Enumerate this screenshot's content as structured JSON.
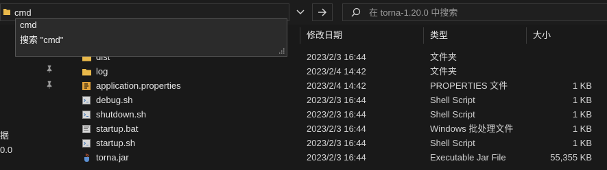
{
  "address_bar": {
    "value": "cmd"
  },
  "search": {
    "placeholder": "在 torna-1.20.0 中搜索"
  },
  "suggestions": [
    "cmd",
    "搜索 \"cmd\""
  ],
  "left_pane": {
    "partial_labels": [
      "据",
      "0.0"
    ]
  },
  "columns": {
    "date": "修改日期",
    "type": "类型",
    "size": "大小"
  },
  "files": [
    {
      "name": "dist",
      "date": "2023/2/3 16:44",
      "type": "文件夹",
      "size": "",
      "icon": "folder-icon"
    },
    {
      "name": "log",
      "date": "2023/2/4 14:42",
      "type": "文件夹",
      "size": "",
      "icon": "folder-icon"
    },
    {
      "name": "application.properties",
      "date": "2023/2/4 14:42",
      "type": "PROPERTIES 文件",
      "size": "1 KB",
      "icon": "properties-file-icon"
    },
    {
      "name": "debug.sh",
      "date": "2023/2/3 16:44",
      "type": "Shell Script",
      "size": "1 KB",
      "icon": "script-file-icon"
    },
    {
      "name": "shutdown.sh",
      "date": "2023/2/3 16:44",
      "type": "Shell Script",
      "size": "1 KB",
      "icon": "script-file-icon"
    },
    {
      "name": "startup.bat",
      "date": "2023/2/3 16:44",
      "type": "Windows 批处理文件",
      "size": "1 KB",
      "icon": "batch-file-icon"
    },
    {
      "name": "startup.sh",
      "date": "2023/2/3 16:44",
      "type": "Shell Script",
      "size": "1 KB",
      "icon": "script-file-icon"
    },
    {
      "name": "torna.jar",
      "date": "2023/2/3 16:44",
      "type": "Executable Jar File",
      "size": "55,355 KB",
      "icon": "jar-file-icon"
    }
  ],
  "colors": {
    "background": "#191919",
    "folder": "#e8b84a",
    "accent_text": "#e6e6e6"
  }
}
